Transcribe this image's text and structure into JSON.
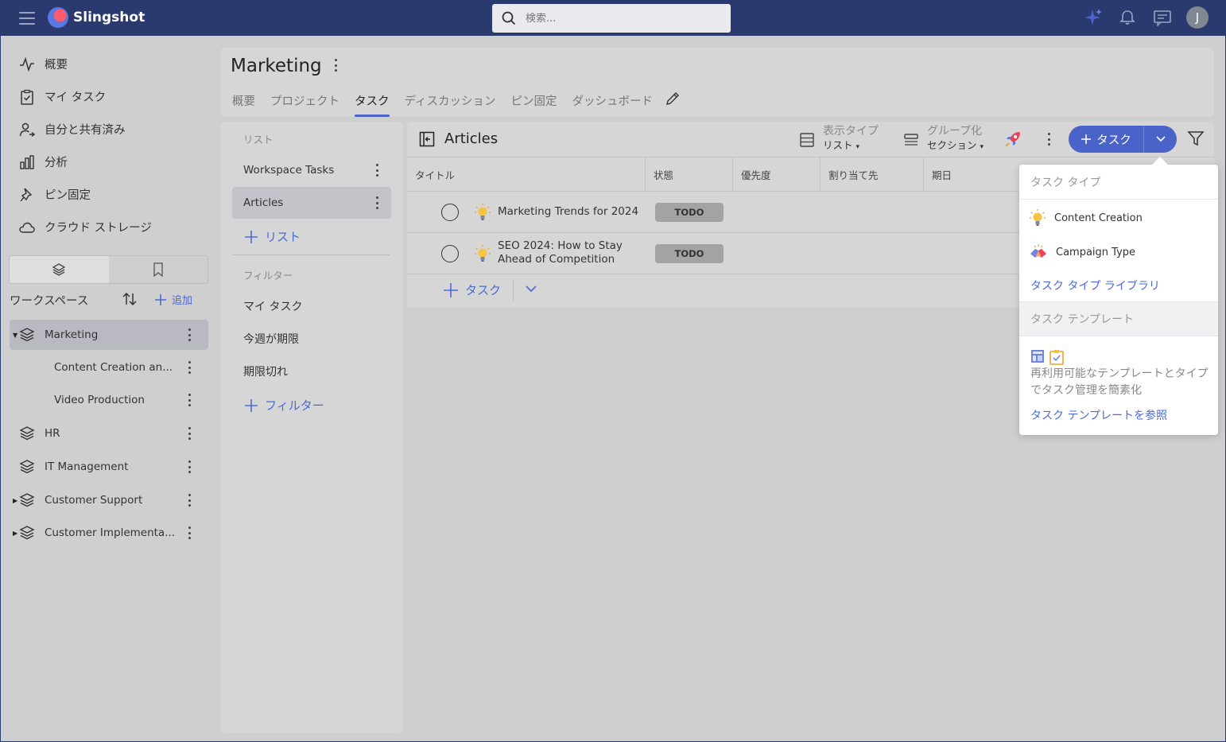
{
  "app": {
    "name": "Slingshot",
    "search_placeholder": "検索...",
    "user_initial": "J"
  },
  "nav": {
    "items": [
      {
        "label": "概要",
        "icon": "activity-icon"
      },
      {
        "label": "マイ タスク",
        "icon": "clipboard-check-icon"
      },
      {
        "label": "自分と共有済み",
        "icon": "user-share-icon"
      },
      {
        "label": "分析",
        "icon": "bar-chart-icon"
      },
      {
        "label": "ピン固定",
        "icon": "pin-icon"
      },
      {
        "label": "クラウド ストレージ",
        "icon": "cloud-icon"
      }
    ],
    "workspace_label": "ワークスペース",
    "add_label": "追加",
    "workspaces": [
      {
        "label": "Marketing",
        "expanded": true,
        "selected": true
      },
      {
        "label": "Content Creation an...",
        "child": true
      },
      {
        "label": "Video Production",
        "child": true
      },
      {
        "label": "HR"
      },
      {
        "label": "IT Management"
      },
      {
        "label": "Customer Support",
        "collapsed": true
      },
      {
        "label": "Customer Implementa...",
        "collapsed": true
      }
    ]
  },
  "header": {
    "title": "Marketing",
    "tabs": [
      {
        "label": "概要"
      },
      {
        "label": "プロジェクト"
      },
      {
        "label": "タスク",
        "active": true
      },
      {
        "label": "ディスカッション"
      },
      {
        "label": "ピン固定"
      },
      {
        "label": "ダッシュボード"
      }
    ]
  },
  "lists": {
    "section_label": "リスト",
    "items": [
      {
        "label": "Workspace Tasks"
      },
      {
        "label": "Articles",
        "selected": true
      }
    ],
    "add_list": "リスト",
    "filter_section": "フィルター",
    "filters": [
      "マイ タスク",
      "今週が期限",
      "期限切れ"
    ],
    "add_filter": "フィルター"
  },
  "main": {
    "title": "Articles",
    "view_type_label": "表示タイプ",
    "view_type_value": "リスト",
    "group_label": "グループ化",
    "group_value": "セクション",
    "add_task_label": "タスク",
    "columns": [
      "タイトル",
      "状態",
      "優先度",
      "割り当て先",
      "期日"
    ],
    "rows": [
      {
        "title": "Marketing Trends for 2024",
        "status": "TODO"
      },
      {
        "title_line1": "SEO 2024: How to Stay",
        "title_line2": "Ahead of Competition",
        "status": "TODO"
      }
    ],
    "add_row_label": "タスク"
  },
  "popover": {
    "task_type_header": "タスク タイプ",
    "types": [
      {
        "label": "Content Creation",
        "icon": "lightbulb-icon"
      },
      {
        "label": "Campaign Type",
        "icon": "handshake-icon"
      }
    ],
    "library_link": "タスク タイプ ライブラリ",
    "template_header": "タスク テンプレート",
    "template_desc": "再利用可能なテンプレートとタイプでタスク管理を簡素化",
    "template_link": "タスク テンプレートを参照"
  },
  "colors": {
    "topbar": "#2b3a6e",
    "accent": "#4a63c9",
    "link": "#4a6ad8"
  }
}
